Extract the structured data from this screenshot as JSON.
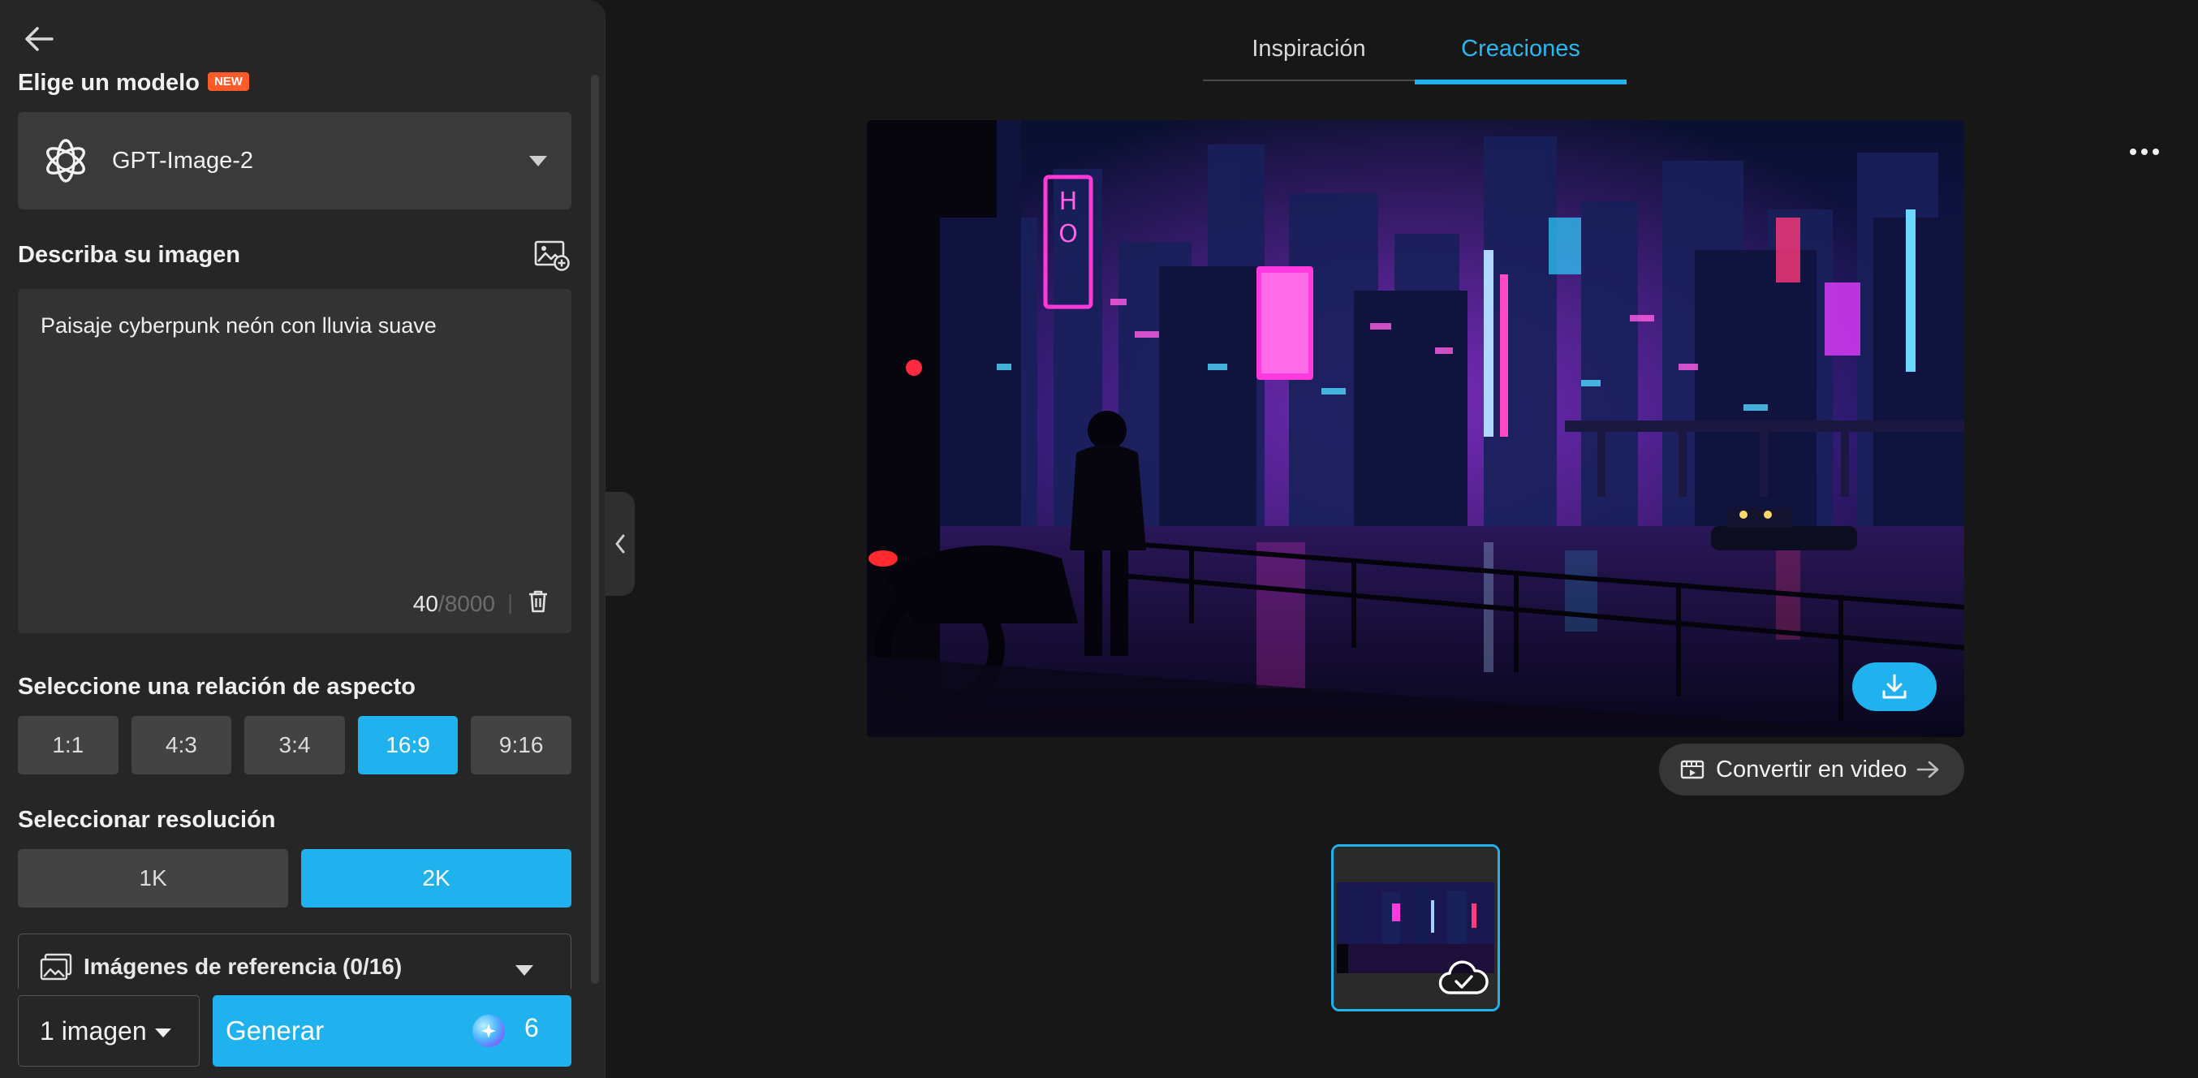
{
  "sidebar": {
    "model_section_label": "Elige un modelo",
    "new_badge": "NEW",
    "model": {
      "name": "GPT-Image-2",
      "icon": "openai-logo-icon"
    },
    "describe_label": "Describa su imagen",
    "prompt": {
      "text": "Paisaje cyberpunk neón con lluvia suave",
      "count": "40",
      "max": "/8000",
      "separator": "|"
    },
    "aspect_label": "Seleccione una relación de aspecto",
    "aspect_ratios": [
      "1:1",
      "4:3",
      "3:4",
      "16:9",
      "9:16"
    ],
    "aspect_selected": "16:9",
    "resolution_label": "Seleccionar resolución",
    "resolutions": [
      "1K",
      "2K"
    ],
    "resolution_selected": "2K",
    "reference_label": "Imágenes de referencia (0/16)",
    "image_count": "1 imagen",
    "generate_label": "Generar",
    "credits": "6"
  },
  "main": {
    "tabs": [
      {
        "label": "Inspiración"
      },
      {
        "label": "Creaciones"
      }
    ],
    "active_tab": "Creaciones",
    "convert_label": "Convertir en video"
  },
  "colors": {
    "accent": "#1fb2ee",
    "panel": "#262626",
    "background": "#171717",
    "badge": "#ff5a2a"
  }
}
